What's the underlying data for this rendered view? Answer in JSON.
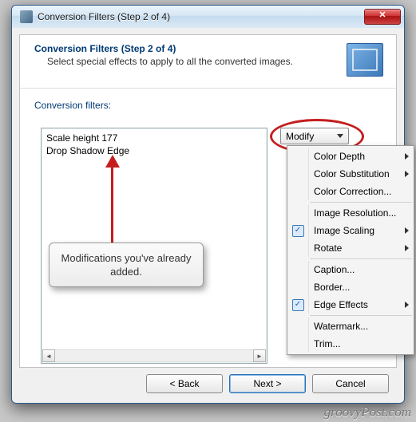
{
  "window": {
    "title": "Conversion Filters (Step 2 of 4)",
    "close": "✕"
  },
  "header": {
    "title": "Conversion Filters (Step 2 of 4)",
    "subtitle": "Select special effects to apply to all the converted images."
  },
  "filtersLabel": "Conversion filters:",
  "filters": {
    "item0": "Scale height 177",
    "item1": "Drop Shadow Edge"
  },
  "modify": {
    "label": "Modify"
  },
  "menu": {
    "colorDepth": "Color Depth",
    "colorSubstitution": "Color Substitution",
    "colorCorrection": "Color Correction...",
    "imageResolution": "Image Resolution...",
    "imageScaling": "Image Scaling",
    "rotate": "Rotate",
    "caption": "Caption...",
    "border": "Border...",
    "edgeEffects": "Edge Effects",
    "watermark": "Watermark...",
    "trim": "Trim..."
  },
  "callout": "Modifications you've already added.",
  "buttons": {
    "back": "< Back",
    "next": "Next >",
    "cancel": "Cancel"
  },
  "watermark": "groovyPost.com"
}
